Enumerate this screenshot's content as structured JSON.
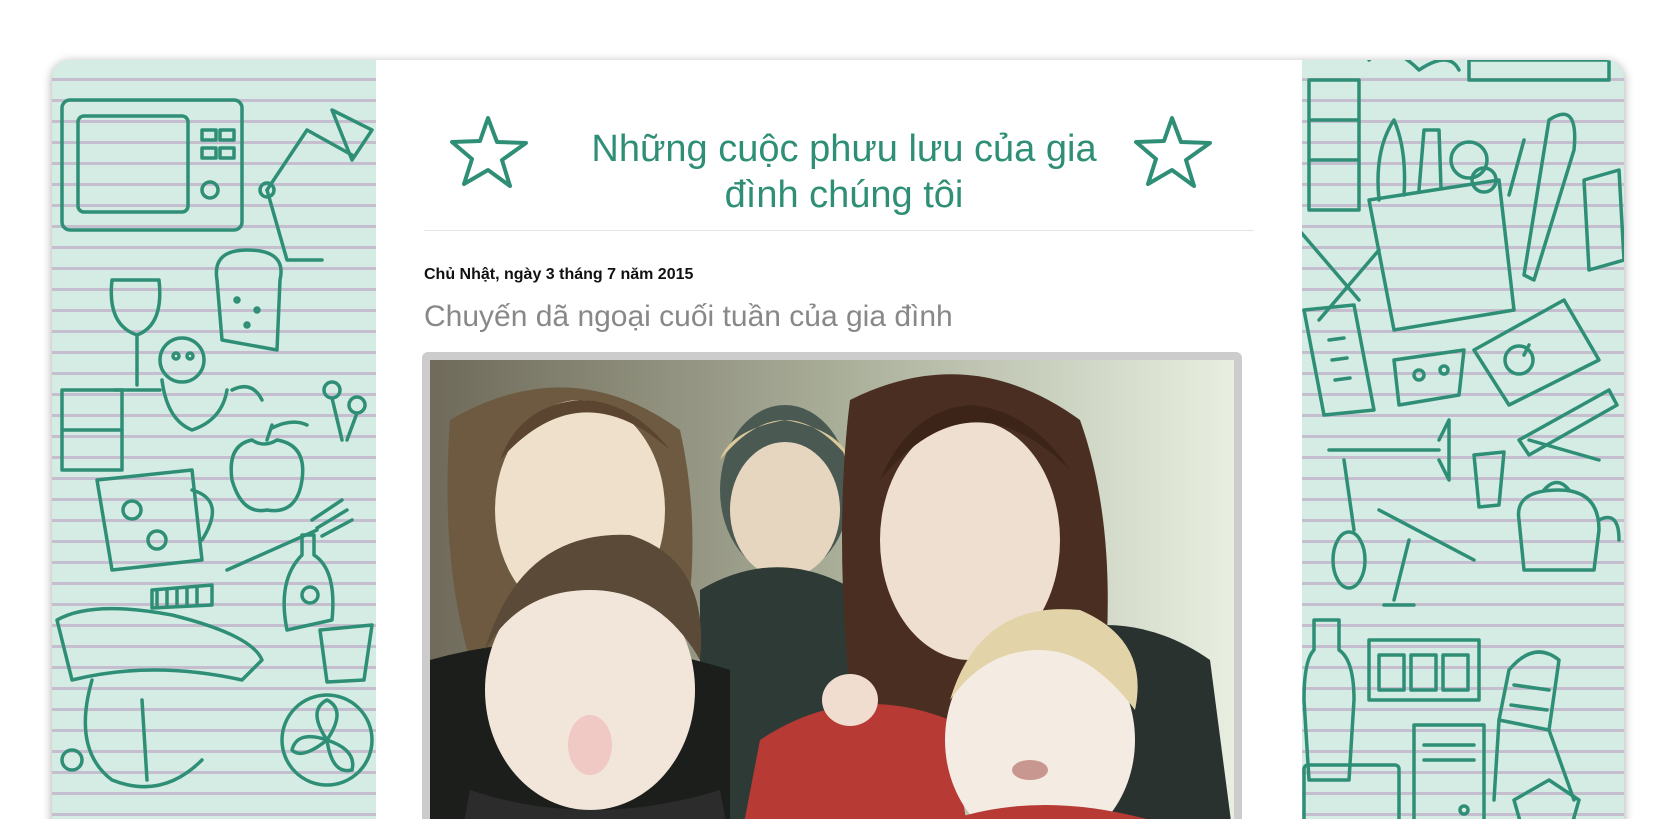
{
  "blog": {
    "title": "Những cuộc phưu lưu của gia đình chúng tôi",
    "accent_color": "#2f8f76",
    "background_color": "#d4ece4"
  },
  "post": {
    "date": "Chủ Nhật, ngày 3 tháng 7 năm 2015",
    "title": "Chuyến dã ngoại cuối tuần của gia đình",
    "photo_icon": "family-selfie-photo"
  },
  "decor": {
    "header_icon": "star-icon",
    "background_icons": [
      "microwave-icon",
      "lamp-icon",
      "wine-glass-icon",
      "toast-icon",
      "dog-icon",
      "mug-icon",
      "apple-icon",
      "fork-icon",
      "comb-icon",
      "bottle-icon",
      "mixer-icon",
      "fan-icon",
      "grocery-bag-icon",
      "knife-icon",
      "cheese-icon",
      "kettle-icon",
      "glass-icon",
      "spoon-icon",
      "broom-icon",
      "dresser-icon",
      "computer-icon",
      "chair-icon",
      "clothespin-icon"
    ]
  }
}
